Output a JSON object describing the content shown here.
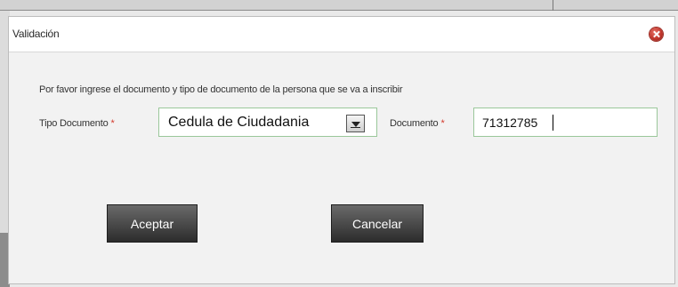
{
  "dialog": {
    "title": "Validación",
    "close_icon": "close-icon"
  },
  "form": {
    "instruction": "Por favor ingrese el documento y tipo de documento de la persona que se va a inscribir",
    "tipo_label": "Tipo Documento",
    "tipo_required_mark": "*",
    "tipo_value": "Cedula de Ciudadania",
    "documento_label": "Documento",
    "documento_required_mark": "*",
    "documento_value": "71312785"
  },
  "buttons": {
    "aceptar": "Aceptar",
    "cancelar": "Cancelar"
  },
  "colors": {
    "required": "#d43b2e",
    "field_border": "#9ac79a",
    "button_bg": "#3a3a3a",
    "close_button": "#c1362c"
  }
}
